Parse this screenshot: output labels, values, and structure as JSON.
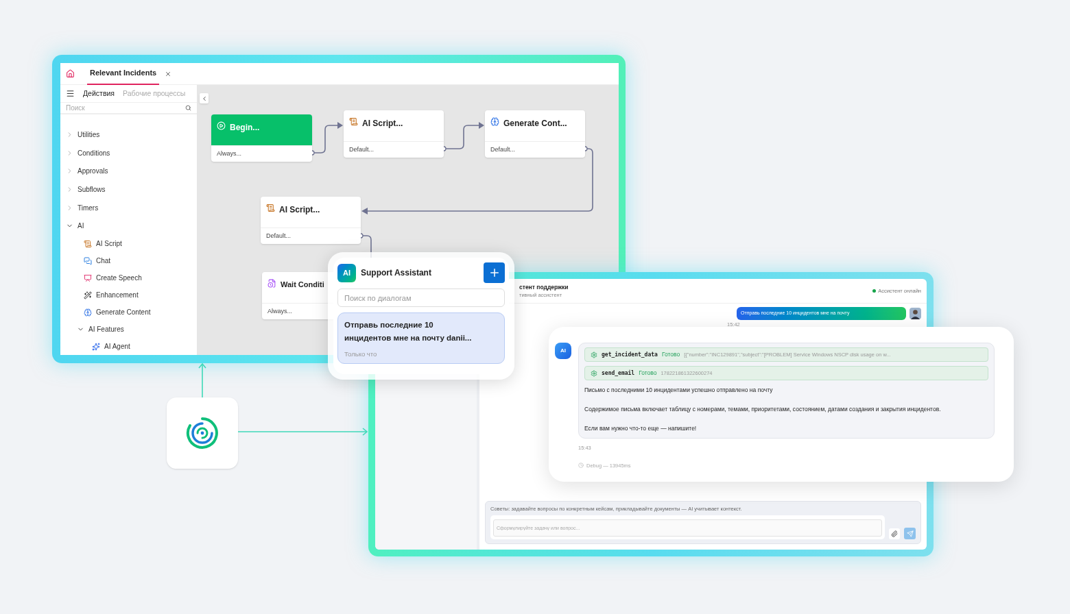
{
  "editor": {
    "tabs": [
      {
        "label": "Relevant Incidents",
        "selected": true
      }
    ],
    "sidebar": {
      "tabs": [
        {
          "label": "Действия",
          "selected": true
        },
        {
          "label": "Рабочие процессы",
          "selected": false
        }
      ],
      "search": {
        "placeholder": "Поиск"
      },
      "tree": [
        {
          "label": "Utilities",
          "expanded": false
        },
        {
          "label": "Conditions",
          "expanded": false
        },
        {
          "label": "Approvals",
          "expanded": false
        },
        {
          "label": "Subflows",
          "expanded": false
        },
        {
          "label": "Timers",
          "expanded": false
        },
        {
          "label": "AI",
          "expanded": true,
          "children": [
            {
              "label": "AI Script",
              "kind": "script"
            },
            {
              "label": "Chat",
              "kind": "chat"
            },
            {
              "label": "Create Speech",
              "kind": "speech"
            },
            {
              "label": "Enhancement",
              "kind": "wand"
            },
            {
              "label": "Generate Content",
              "kind": "brain"
            },
            {
              "label": "AI Features",
              "kind": "group",
              "expanded": true,
              "children": [
                {
                  "label": "AI Agent",
                  "kind": "agent"
                }
              ]
            }
          ]
        }
      ]
    },
    "canvas": {
      "nodes": [
        {
          "kind": "start",
          "title": "Begin...",
          "footer": "Always..."
        },
        {
          "kind": "script",
          "title": "AI Script...",
          "footer": "Default..."
        },
        {
          "kind": "brain",
          "title": "Generate Cont...",
          "footer": "Default..."
        },
        {
          "kind": "script",
          "title": "AI Script...",
          "footer": "Default..."
        },
        {
          "kind": "wait",
          "title": "Wait Conditi",
          "footer": "Always..."
        }
      ]
    }
  },
  "popup": {
    "badge": "AI",
    "title": "Support Assistant",
    "search": {
      "placeholder": "Поиск по диалогам"
    },
    "dialogs": [
      {
        "title": "Отправь последние 10 инцидентов мне на почту danii...",
        "time": "Только что",
        "selected": true
      }
    ]
  },
  "chat": {
    "header": {
      "title": "стент поддержки",
      "subtitle": "тивный ассистент",
      "status": "Ассистент онлайн",
      "online": true
    },
    "messages": [
      {
        "kind": "user",
        "text": "Отправь последние 10 инцидентов мне на почту",
        "time": "15:42"
      },
      {
        "kind": "assistant",
        "avatar": "AI",
        "tools": [
          {
            "name": "get_incident_data",
            "status": "Готово",
            "result": "[{\"number\":\"INC129891\",\"subject\":\"[PROBLEM] Service Windows NSCP disk usage on w..."
          },
          {
            "name": "send_email",
            "status": "Готово",
            "result": "178221861322600274"
          }
        ],
        "paragraphs": [
          "Письмо с последними 10 инцидентами успешно отправлено на почту",
          "Содержимое письма включает таблицу с номерами, темами, приоритетами, состоянием, датами создания и закрытия инцидентов.",
          "Если вам нужно что-то еще — напишите!"
        ],
        "time": "15:43",
        "debug": "Debug — 13945ms"
      }
    ],
    "composer": {
      "hint": "Советы: задавайте вопросы по конкретным кейсам, прикладывайте документы — AI учитывает контекст.",
      "placeholder": "Сформулируйте задачу или вопрос..."
    }
  }
}
